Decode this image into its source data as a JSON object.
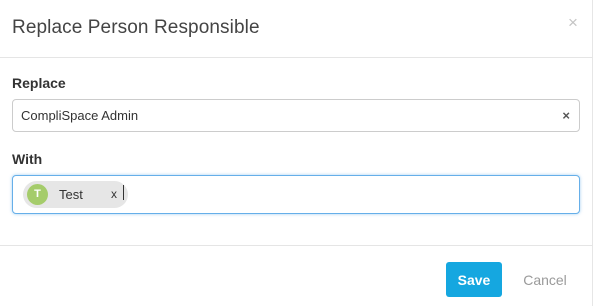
{
  "modal": {
    "title": "Replace Person Responsible",
    "close_glyph": "×"
  },
  "replace_field": {
    "label": "Replace",
    "selected_value": "CompliSpace Admin",
    "clear_glyph": "×"
  },
  "with_field": {
    "label": "With",
    "tags": [
      {
        "initial": "T",
        "label": "Test",
        "remove_glyph": "x",
        "avatar_color": "#a5cc6b"
      }
    ],
    "input_value": ""
  },
  "footer": {
    "save_label": "Save",
    "cancel_label": "Cancel"
  },
  "colors": {
    "primary": "#15a7e0",
    "focus_border": "#66afe9",
    "chip_background": "#e6e6e6"
  }
}
